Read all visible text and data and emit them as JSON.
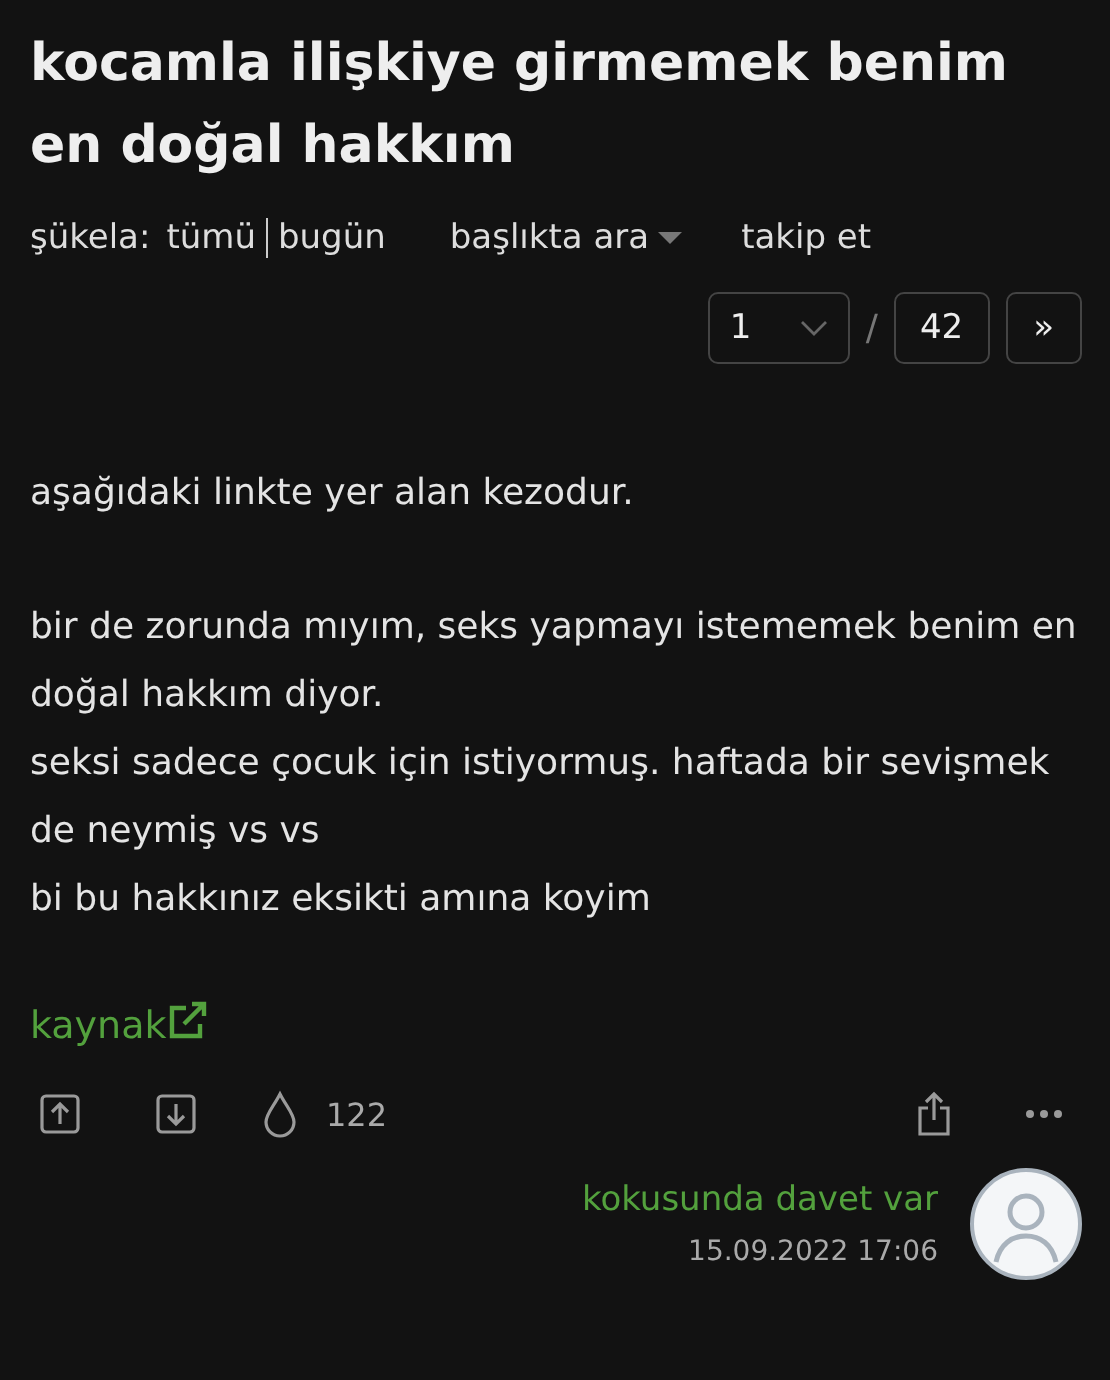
{
  "topic": {
    "title": "kocamla ilişkiye girmemek benim en doğal hakkım"
  },
  "filters": {
    "label": "şükela:",
    "options": [
      {
        "label": "tümü"
      },
      {
        "label": "bugün"
      }
    ],
    "search": "başlıkta ara",
    "follow": "takip et"
  },
  "pager": {
    "current": "1",
    "separator": "/",
    "total": "42",
    "next": "»"
  },
  "entry": {
    "paragraphs": [
      "aşağıdaki linkte yer alan kezodur.",
      "bir de zorunda mıyım, seks yapmayı istememek benim en doğal hakkım diyor.\nseksi sadece çocuk için istiyormuş. haftada bir sevişmek de neymiş vs vs\nbi bu hakkınız eksikti amına koyim"
    ],
    "link": "kaynak",
    "favorites": "122",
    "author": "kokusunda davet var",
    "date": "15.09.2022 17:06"
  }
}
